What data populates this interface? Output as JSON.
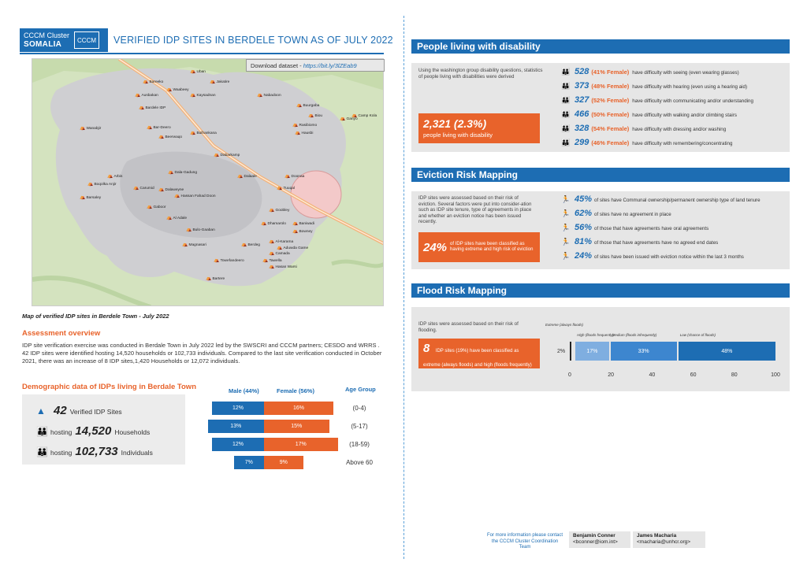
{
  "header": {
    "logo_line1": "CCCM Cluster",
    "logo_line2": "SOMALIA",
    "logo_mark": "CCCM",
    "title": "VERIFIED IDP SITES IN BERDELE TOWN AS OF JULY 2022"
  },
  "map": {
    "download_label": "Download dataset - ",
    "download_link": "https://bit.ly/3lZEab9",
    "caption": "Map of verified IDP sites in Berdele Town - July 2022",
    "labels": [
      "Uban",
      "Bareeko",
      "Jakatire",
      "Waabeey",
      "Ausbakan",
      "Kaysadnan",
      "Nabadoon",
      "Bardele IDP",
      "Buurgaba",
      "Biou",
      "Wanabjir",
      "Rasibiomo",
      "Hausbi",
      "Ganyo",
      "Camp Kola",
      "Bar-Deero",
      "Beerwaqo",
      "Bulhankana",
      "Dabarkamp",
      "Dala-Gadung",
      "Arbis",
      "Dalaale",
      "Boqolka Anjir",
      "Carumid",
      "Doonaa",
      "Barsaley",
      "Tuuqal",
      "Dalaweyne",
      "Hassan Fahad Doon",
      "Gaboor",
      "Goobley",
      "Dhamarolo",
      "Al Adale",
      "Baniwadi",
      "Bulo-Gaaban",
      "Bowney",
      "Magnasari",
      "Berdeg",
      "Al-Karama",
      "Camada",
      "Aduwda Game",
      "Towefandeero",
      "Tawella",
      "Hasan Warsi",
      "Bartere"
    ]
  },
  "overview": {
    "heading": "Assessment overview",
    "text": "IDP site verification exercise was conducted in Berdale Town in July 2022 led by the SWSCRI and CCCM partners; CESDO and WRRS . 42 IDP sites were identified hosting 14,520 households or 102,733 individuals. Compared to the last site verification conducted in October 2021, there was an increase of 8 IDP sites,1,420 Households or 12,072 individuals."
  },
  "demographics": {
    "heading": "Demographic data of IDPs living in Berdale Town",
    "sites_num": "42",
    "sites_label": "Verified IDP Sites",
    "hh_prefix": "hosting",
    "hh_num": "14,520",
    "hh_label": "Households",
    "ind_prefix": "hosting",
    "ind_num": "102,733",
    "ind_label": "Individuals",
    "male_header": "Male (44%)",
    "female_header": "Female (56%)",
    "age_header": "Age Group",
    "rows": [
      {
        "age": "(0-4)",
        "male": 12,
        "female": 16,
        "male_label": "12%",
        "female_label": "16%"
      },
      {
        "age": "(5-17)",
        "male": 13,
        "female": 15,
        "male_label": "13%",
        "female_label": "15%"
      },
      {
        "age": "(18-59)",
        "male": 12,
        "female": 17,
        "male_label": "12%",
        "female_label": "17%"
      },
      {
        "age": "Above 60",
        "male": 7,
        "female": 9,
        "male_label": "7%",
        "female_label": "9%"
      }
    ]
  },
  "disability": {
    "title": "People living with disability",
    "intro": "Using the washington group disability questions, statistics of people living with disabilities were derived",
    "callout_value": "2,321 (2.3%)",
    "callout_label": "people living with disability",
    "items": [
      {
        "num": "528",
        "female": "(41% Female)",
        "text": "have difficulty with seeing (even wearing glasses)"
      },
      {
        "num": "373",
        "female": "(48% Female)",
        "text": "have difficulty with hearing (even using a hearing aid)"
      },
      {
        "num": "327",
        "female": "(52% Female)",
        "text": "have difficulty with communicating and/or understanding"
      },
      {
        "num": "466",
        "female": "(50% Female)",
        "text": "have difficulty with walking and/or climbing stairs"
      },
      {
        "num": "328",
        "female": "(54% Female)",
        "text": "have difficulty with dressing and/or washing"
      },
      {
        "num": "299",
        "female": "(46% Female)",
        "text": "have difficulty with remembering/concentrating"
      }
    ]
  },
  "eviction": {
    "title": "Eviction Risk Mapping",
    "intro": "IDP sites were assessed based on their risk of eviction. Several factors were put into consider-ation such as IDP site tenure, type of agreements in place and whether an eviction notice has been issued recently.",
    "callout_value": "24%",
    "callout_label": "of IDP sites have been classified as having extreme and high risk of eviction",
    "items": [
      {
        "num": "45%",
        "text": "of sites have Communal ownership/permanent ownership type of land tenure"
      },
      {
        "num": "62%",
        "text": "of sites have no agreement in place"
      },
      {
        "num": "56%",
        "text": "of those that have agreements have oral agreements"
      },
      {
        "num": "81%",
        "text": "of those that have agreements have no agreed end dates"
      },
      {
        "num": "24%",
        "text": "of sites have been issued with eviction notice within the last 3 months"
      }
    ]
  },
  "flood": {
    "title": "Flood Risk Mapping",
    "intro": "IDP sites were assessed based on their risk of flooding.",
    "callout_value": "8",
    "callout_label": "IDP sites (19%) have been classified as extreme (always floods) and high (floods frequently)",
    "chart_data": {
      "type": "bar",
      "orientation": "horizontal-stacked",
      "categories": [
        "Extreme (always floods)",
        "High (floods frequently)",
        "Medium (floods infrequently)",
        "Low (chance of floods)"
      ],
      "values": [
        2,
        17,
        33,
        48
      ],
      "value_labels": [
        "2%",
        "17%",
        "33%",
        "48%"
      ],
      "colors": [
        "#222222",
        "#7faee0",
        "#3d86cf",
        "#1d6db3"
      ],
      "xlim": [
        0,
        100
      ],
      "ticks": [
        "0",
        "20",
        "40",
        "60",
        "80",
        "100"
      ]
    }
  },
  "footer": {
    "note": "For more information please contact the CCCM Cluster Coordination Team",
    "contact1_name": "Benjamin Conner",
    "contact1_email": "<bconner@iom.int>",
    "contact2_name": "James Macharia",
    "contact2_email": "<macharia@unhcr.org>"
  },
  "colors": {
    "brand_blue": "#1d6db3",
    "accent_orange": "#e8632b",
    "panel_grey": "#e6e6e6"
  }
}
